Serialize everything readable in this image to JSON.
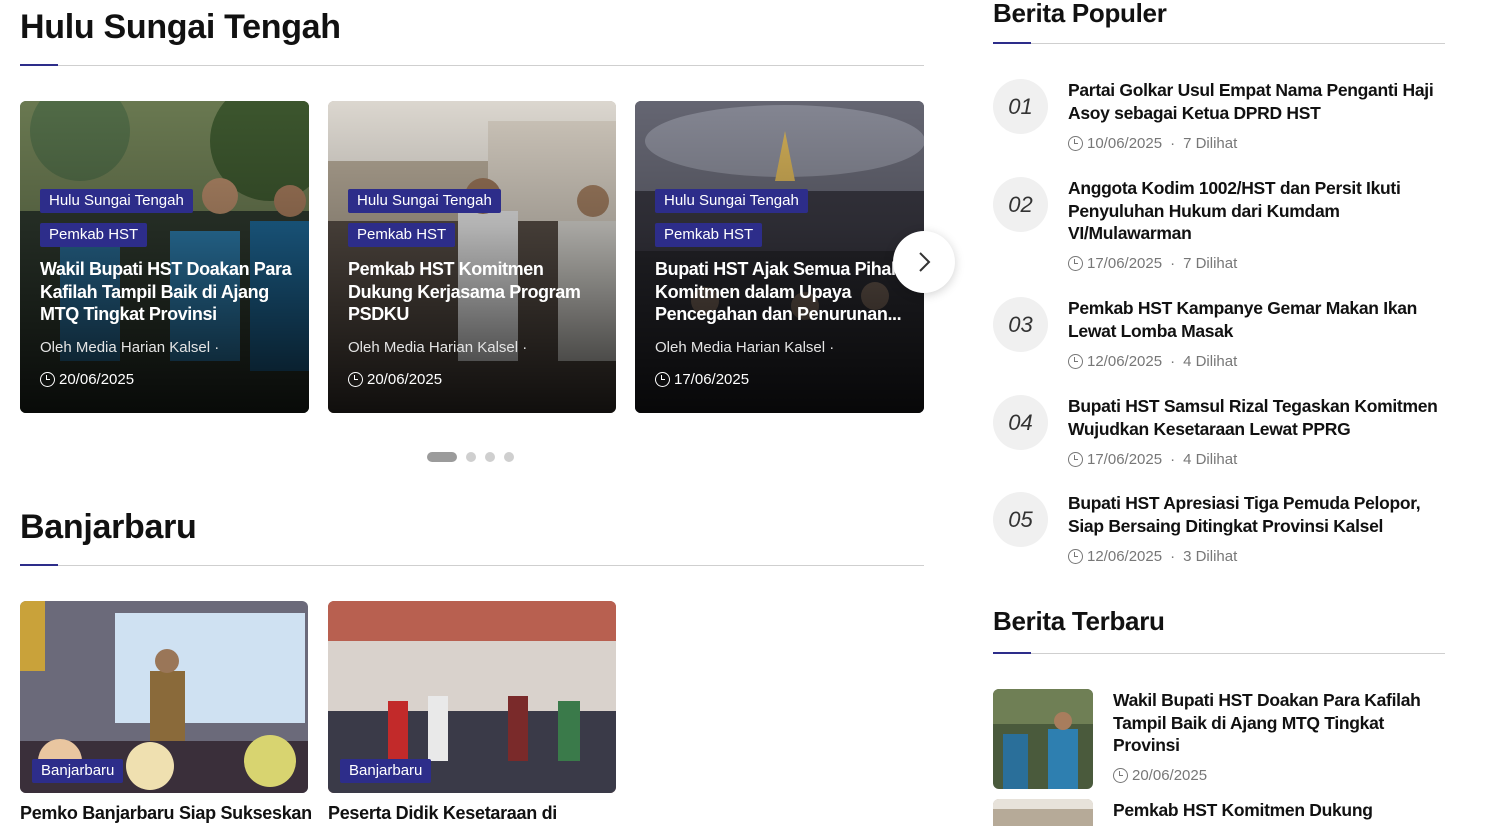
{
  "sections": {
    "hst": {
      "title": "Hulu Sungai Tengah",
      "cards": [
        {
          "category": "Hulu Sungai Tengah",
          "subcategory": "Pemkab HST",
          "title": "Wakil Bupati HST Doakan Para Kafilah Tampil Baik di Ajang MTQ Tingkat Provinsi",
          "author": "Oleh Media Harian Kalsel",
          "date": "20/06/2025"
        },
        {
          "category": "Hulu Sungai Tengah",
          "subcategory": "Pemkab HST",
          "title": "Pemkab HST Komitmen Dukung Kerjasama Program PSDKU",
          "author": "Oleh Media Harian Kalsel",
          "date": "20/06/2025"
        },
        {
          "category": "Hulu Sungai Tengah",
          "subcategory": "Pemkab HST",
          "title": "Bupati HST Ajak Semua Pihak Komitmen dalam Upaya Pencegahan dan Penurunan...",
          "author": "Oleh Media Harian Kalsel",
          "date": "17/06/2025"
        }
      ]
    },
    "banjarbaru": {
      "title": "Banjarbaru",
      "cards": [
        {
          "category": "Banjarbaru",
          "title": "Pemko Banjarbaru Siap Sukseskan"
        },
        {
          "category": "Banjarbaru",
          "title": "Peserta Didik Kesetaraan di"
        }
      ]
    }
  },
  "popular": {
    "title": "Berita Populer",
    "items": [
      {
        "num": "01",
        "title": "Partai Golkar Usul Empat Nama Penganti Haji Asoy sebagai Ketua DPRD HST",
        "date": "10/06/2025",
        "views": "7 Dilihat"
      },
      {
        "num": "02",
        "title": "Anggota Kodim 1002/HST dan Persit Ikuti Penyuluhan Hukum dari Kumdam VI/Mulawarman",
        "date": "17/06/2025",
        "views": "7 Dilihat"
      },
      {
        "num": "03",
        "title": "Pemkab HST Kampanye Gemar Makan Ikan Lewat Lomba Masak",
        "date": "12/06/2025",
        "views": "4 Dilihat"
      },
      {
        "num": "04",
        "title": "Bupati HST Samsul Rizal Tegaskan Komitmen Wujudkan Kesetaraan Lewat PPRG",
        "date": "17/06/2025",
        "views": "4 Dilihat"
      },
      {
        "num": "05",
        "title": "Bupati HST Apresiasi Tiga Pemuda Pelopor, Siap Bersaing Ditingkat Provinsi Kalsel",
        "date": "12/06/2025",
        "views": "3 Dilihat"
      }
    ]
  },
  "latest": {
    "title": "Berita Terbaru",
    "items": [
      {
        "title": "Wakil Bupati HST Doakan Para Kafilah Tampil Baik di Ajang MTQ Tingkat Provinsi",
        "date": "20/06/2025"
      },
      {
        "title": "Pemkab HST Komitmen Dukung"
      }
    ]
  },
  "colors": {
    "accent": "#2d2d8a",
    "text": "#111111",
    "meta": "#777777"
  },
  "icons": {
    "clock": "clock-icon",
    "next": "chevron-right-icon"
  },
  "carousel": {
    "active_dot_index": 0,
    "dot_count": 4
  }
}
